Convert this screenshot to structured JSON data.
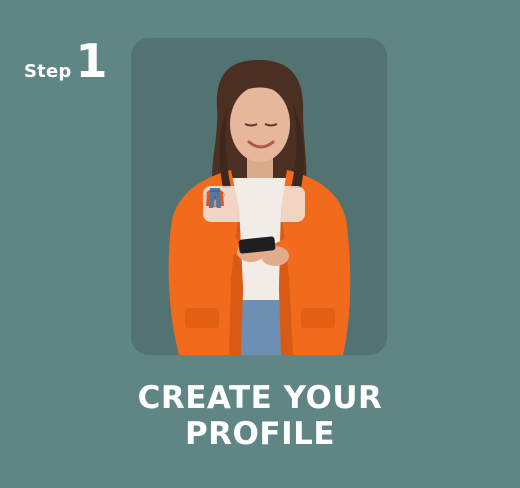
{
  "step": {
    "word": "Step",
    "number": "1"
  },
  "outfit_icons": [
    "t-shirt-icon",
    "jacket-icon",
    "jeans-icon"
  ],
  "headline": {
    "line1": "CREATE YOUR",
    "line2": "PROFILE"
  },
  "colors": {
    "background": "#5f8584",
    "card": "#527372",
    "jacket": "#f26b1d",
    "text": "#ffffff"
  }
}
